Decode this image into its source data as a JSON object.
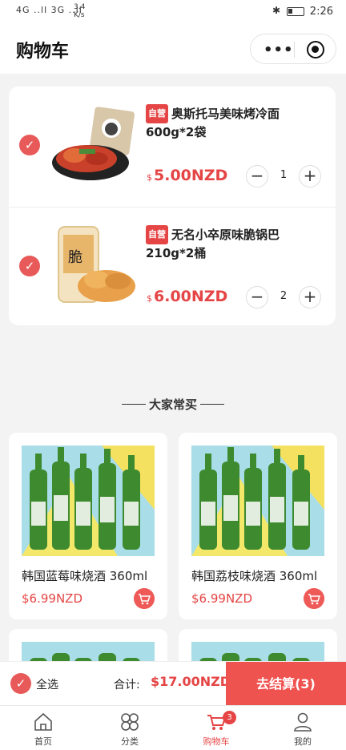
{
  "status_bar": {
    "signal": "4G ..ll 3G ..ll",
    "speed": "3.4 K/s",
    "time": "2:26"
  },
  "nav": {
    "title": "购物车"
  },
  "cart": {
    "items": [
      {
        "tag": "自营",
        "name": "奥斯托马美味烤冷面 600g*2袋",
        "currency": "$",
        "price": "5.00NZD",
        "qty": "1"
      },
      {
        "tag": "自营",
        "name": "无名小卒原味脆锅巴 210g*2桶",
        "currency": "$",
        "price": "6.00NZD",
        "qty": "2"
      }
    ]
  },
  "recommend": {
    "title": "大家常买",
    "products": [
      {
        "name": "韩国蓝莓味烧酒 360ml",
        "price": "$6.99NZD"
      },
      {
        "name": "韩国荔枝味烧酒 360ml",
        "price": "$6.99NZD"
      },
      {
        "name": "",
        "price": ""
      },
      {
        "name": "",
        "price": ""
      }
    ]
  },
  "checkout": {
    "select_all": "全选",
    "total_label": "合计:",
    "total": "$17.00NZD",
    "button": "去结算(3)"
  },
  "tabbar": {
    "tabs": [
      {
        "label": "首页",
        "icon": "home-icon"
      },
      {
        "label": "分类",
        "icon": "category-icon"
      },
      {
        "label": "购物车",
        "icon": "cart-icon",
        "badge": "3"
      },
      {
        "label": "我的",
        "icon": "profile-icon"
      }
    ]
  },
  "colors": {
    "accent": "#e54545",
    "button": "#ef5350",
    "background": "#f3f3f3"
  }
}
